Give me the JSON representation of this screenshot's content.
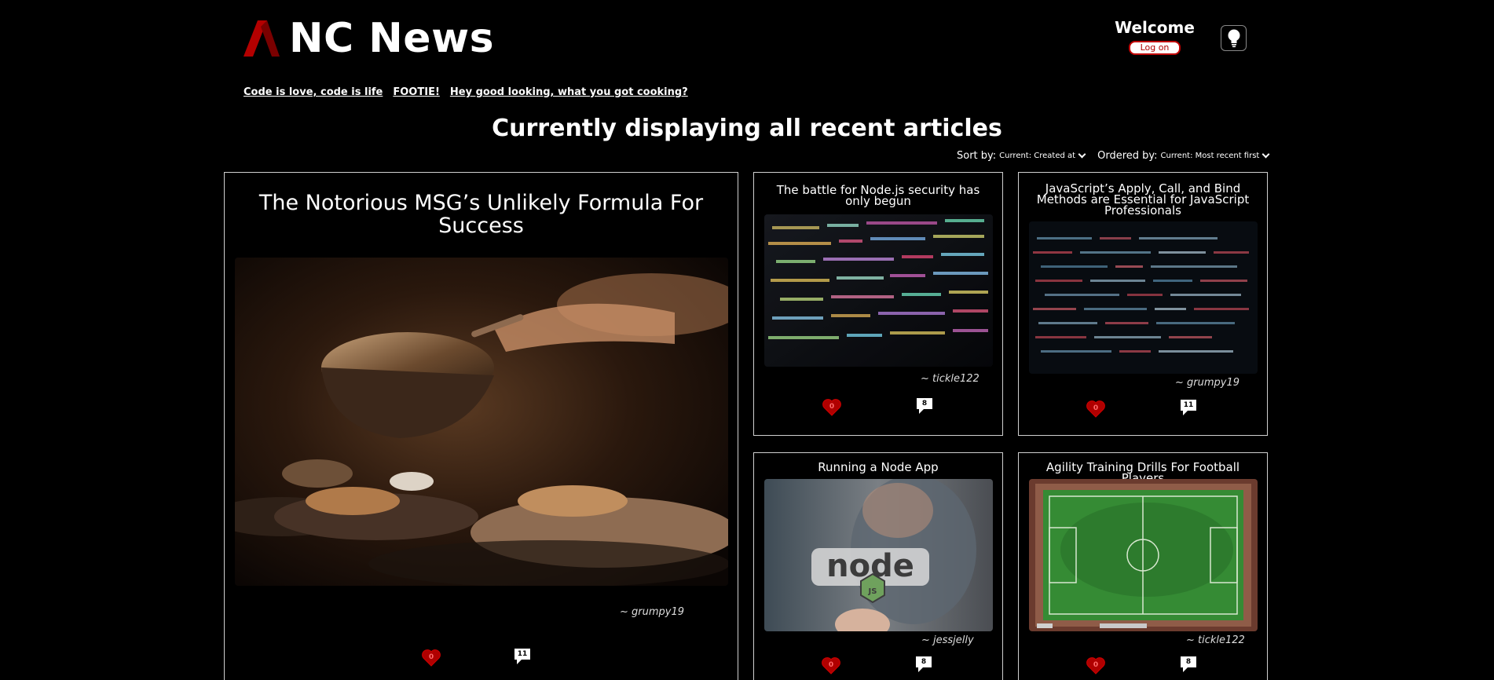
{
  "header": {
    "logo_text": "NC News",
    "welcome_text": "Welcome",
    "login_label": "Log on",
    "theme_icon": "lightbulb-icon"
  },
  "topics": [
    "Code is love, code is life",
    "FOOTIE!",
    "Hey good looking, what you got cooking?"
  ],
  "main": {
    "title": "Currently displaying all recent articles",
    "sort": {
      "sort_label": "Sort by:",
      "sort_value": "Current: Created at",
      "order_label": "Ordered by:",
      "order_value": "Current: Most recent first"
    }
  },
  "articles": [
    {
      "title": "The Notorious MSG’s Unlikely Formula For Success",
      "author": "~ grumpy19",
      "votes": "0",
      "comments": "11",
      "image_subject": "cooking-pan-photo"
    },
    {
      "title": "The battle for Node.js security has only begun",
      "author": "~ tickle122",
      "votes": "0",
      "comments": "8",
      "image_subject": "code-screen-photo"
    },
    {
      "title": "JavaScript’s Apply, Call, and Bind Methods are Essential for JavaScript Professionals",
      "author": "~ grumpy19",
      "votes": "0",
      "comments": "11",
      "image_subject": "code-screen-dark-photo"
    },
    {
      "title": "Running a Node App",
      "author": "~ jessjelly",
      "votes": "0",
      "comments": "8",
      "image_subject": "node-sticker-photo"
    },
    {
      "title": "Agility Training Drills For Football Players",
      "author": "~ tickle122",
      "votes": "0",
      "comments": "8",
      "image_subject": "football-pitch-aerial-photo"
    }
  ],
  "colors": {
    "accent": "#c00000",
    "background": "#000000",
    "border": "#d0d0d0"
  }
}
